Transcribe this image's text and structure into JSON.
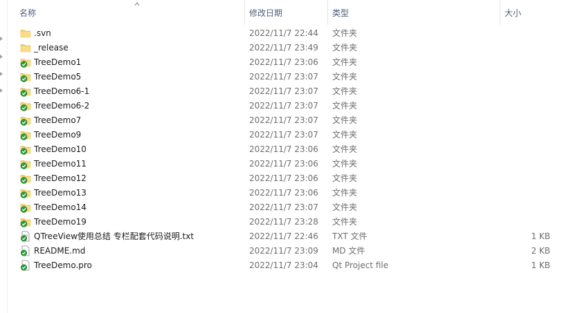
{
  "header": {
    "name": "名称",
    "date": "修改日期",
    "type": "类型",
    "size": "大小"
  },
  "icons": {
    "folder": "folder-icon",
    "svn_folder": "svn-folder-icon",
    "text_file": "text-file-icon",
    "markdown_file": "markdown-file-icon",
    "project_file": "qt-project-file-icon"
  },
  "colors": {
    "folder_yellow": "#f3d26b",
    "svn_check_green": "#2e9b3a",
    "header_text": "#4c607a"
  },
  "files": [
    {
      "name": ".svn",
      "date": "2022/11/7 22:44",
      "type": "文件夹",
      "size": "",
      "icon": "folder"
    },
    {
      "name": "_release",
      "date": "2022/11/7 23:49",
      "type": "文件夹",
      "size": "",
      "icon": "folder"
    },
    {
      "name": "TreeDemo1",
      "date": "2022/11/7 23:06",
      "type": "文件夹",
      "size": "",
      "icon": "svn_folder"
    },
    {
      "name": "TreeDemo5",
      "date": "2022/11/7 23:07",
      "type": "文件夹",
      "size": "",
      "icon": "svn_folder"
    },
    {
      "name": "TreeDemo6-1",
      "date": "2022/11/7 23:07",
      "type": "文件夹",
      "size": "",
      "icon": "svn_folder"
    },
    {
      "name": "TreeDemo6-2",
      "date": "2022/11/7 23:07",
      "type": "文件夹",
      "size": "",
      "icon": "svn_folder"
    },
    {
      "name": "TreeDemo7",
      "date": "2022/11/7 23:07",
      "type": "文件夹",
      "size": "",
      "icon": "svn_folder"
    },
    {
      "name": "TreeDemo9",
      "date": "2022/11/7 23:07",
      "type": "文件夹",
      "size": "",
      "icon": "svn_folder"
    },
    {
      "name": "TreeDemo10",
      "date": "2022/11/7 23:06",
      "type": "文件夹",
      "size": "",
      "icon": "svn_folder"
    },
    {
      "name": "TreeDemo11",
      "date": "2022/11/7 23:06",
      "type": "文件夹",
      "size": "",
      "icon": "svn_folder"
    },
    {
      "name": "TreeDemo12",
      "date": "2022/11/7 23:06",
      "type": "文件夹",
      "size": "",
      "icon": "svn_folder"
    },
    {
      "name": "TreeDemo13",
      "date": "2022/11/7 23:06",
      "type": "文件夹",
      "size": "",
      "icon": "svn_folder"
    },
    {
      "name": "TreeDemo14",
      "date": "2022/11/7 23:07",
      "type": "文件夹",
      "size": "",
      "icon": "svn_folder"
    },
    {
      "name": "TreeDemo19",
      "date": "2022/11/7 23:28",
      "type": "文件夹",
      "size": "",
      "icon": "svn_folder"
    },
    {
      "name": "QTreeView使用总结 专栏配套代码说明.txt",
      "date": "2022/11/7 22:46",
      "type": "TXT 文件",
      "size": "1 KB",
      "icon": "text_file"
    },
    {
      "name": "README.md",
      "date": "2022/11/7 23:09",
      "type": "MD 文件",
      "size": "2 KB",
      "icon": "markdown_file"
    },
    {
      "name": "TreeDemo.pro",
      "date": "2022/11/7 23:04",
      "type": "Qt Project file",
      "size": "1 KB",
      "icon": "project_file"
    }
  ]
}
